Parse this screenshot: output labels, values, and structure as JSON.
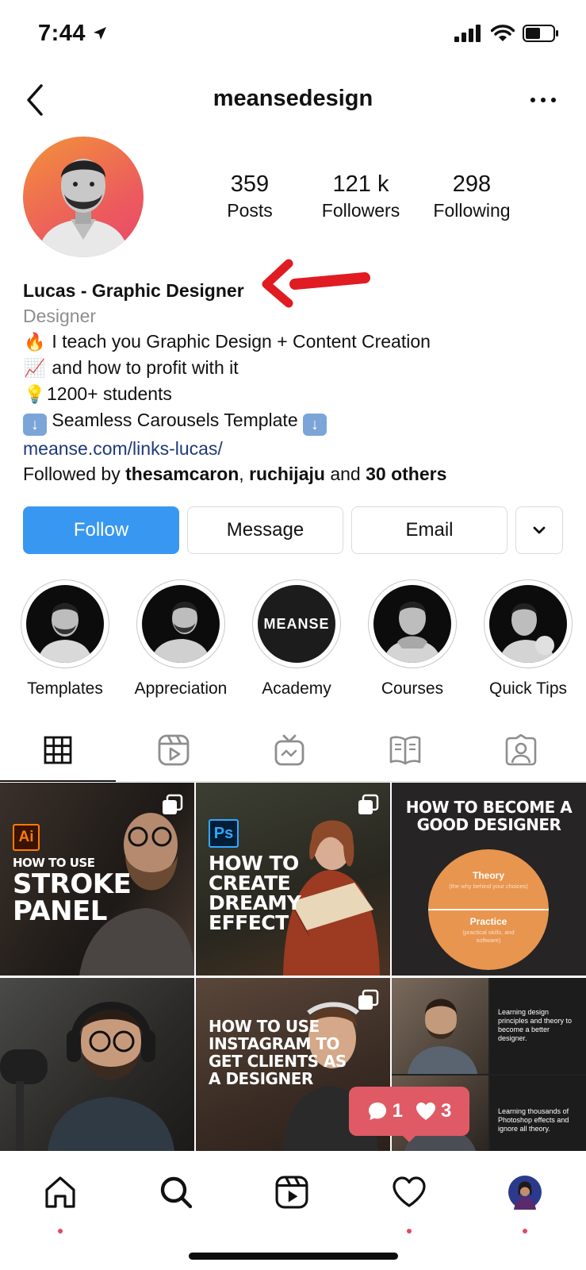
{
  "status_bar": {
    "time": "7:44"
  },
  "header": {
    "username": "meansedesign"
  },
  "stats": [
    {
      "value": "359",
      "label": "Posts"
    },
    {
      "value": "121 k",
      "label": "Followers"
    },
    {
      "value": "298",
      "label": "Following"
    }
  ],
  "bio": {
    "name": "Lucas - Graphic Designer",
    "category": "Designer",
    "line1": "I teach you Graphic Design + Content Creation",
    "line2": "and how to profit with it",
    "line3": "1200+ students",
    "line4": "Seamless Carousels Template",
    "link": "meanse.com/links-lucas/",
    "followed_prefix": "Followed by ",
    "followed_user1": "thesamcaron",
    "followed_sep": ", ",
    "followed_user2": "ruchijaju",
    "followed_and": " and ",
    "followed_others": "30 others"
  },
  "actions": {
    "follow": "Follow",
    "message": "Message",
    "email": "Email"
  },
  "highlights": [
    {
      "label": "Templates"
    },
    {
      "label": "Appreciation"
    },
    {
      "label": "Academy",
      "text": "MEANSE"
    },
    {
      "label": "Courses"
    },
    {
      "label": "Quick Tips"
    }
  ],
  "posts": {
    "p1": {
      "badge": "Ai",
      "line1": "How to use",
      "line2": "Stroke",
      "line3": "Panel"
    },
    "p2": {
      "badge": "Ps",
      "line1": "How to",
      "line2": "create",
      "line3": "dreamy",
      "line4": "effect"
    },
    "p3": {
      "title1": "How to become a",
      "title2": "good designer",
      "theory": "Theory",
      "theory_sub": "(the why behind your choices)",
      "practice": "Practice",
      "practice_sub": "(practical skills, and software)"
    },
    "p5": {
      "line1": "How to use",
      "line2": "Instagram to",
      "line3": "get clients as",
      "line4": "a designer"
    },
    "p6": {
      "text1": "Learning design principles and theory to become a better designer.",
      "text2": "Learning thousands of Photoshop effects and ignore all theory."
    }
  },
  "notification": {
    "comments": "1",
    "likes": "3"
  },
  "colors": {
    "follow": "#3897f0",
    "notif": "#e05a66",
    "avatar_gradient": [
      "#f2923a",
      "#e8496a"
    ],
    "practice_circle": "#e8954f"
  }
}
